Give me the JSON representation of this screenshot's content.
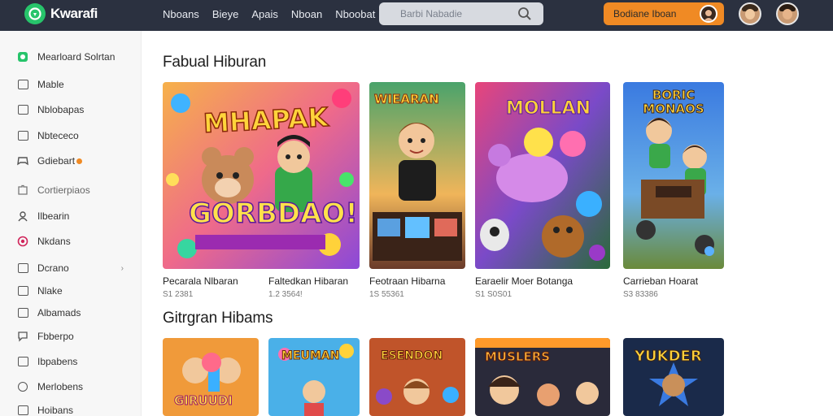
{
  "app": {
    "name": "Kwarafi"
  },
  "nav": [
    "Nboans",
    "Bieye",
    "Apais",
    "Nboan",
    "Nboobat"
  ],
  "search": {
    "placeholder": "Barbi Nabadie"
  },
  "cta": {
    "label": "Bodiane Iboan"
  },
  "sidebar": {
    "items": [
      {
        "label": "Mearloard Solrtan",
        "icon": "gamepad-icon",
        "color": "#27c46b"
      },
      {
        "label": "Mable",
        "icon": "window-icon"
      },
      {
        "label": "Nblobapas",
        "icon": "window-icon"
      },
      {
        "label": "Nbtececo",
        "icon": "window-icon"
      },
      {
        "label": "Gdiebart",
        "icon": "controller-icon"
      },
      {
        "label": "Cortierpiaos",
        "icon": "puzzle-icon"
      },
      {
        "label": "Ilbearin",
        "icon": "person-icon"
      },
      {
        "label": "Nkdans",
        "icon": "record-icon",
        "color": "#d0245a"
      },
      {
        "label": "Dcrano",
        "icon": "window-icon",
        "chevron": "›"
      },
      {
        "label": "Nlake",
        "icon": "window-icon"
      },
      {
        "label": "Albamads",
        "icon": "window-icon"
      },
      {
        "label": "Fbberpo",
        "icon": "chat-icon"
      },
      {
        "label": "Ibpabens",
        "icon": "window-icon"
      },
      {
        "label": "Merlobens",
        "icon": "globe-icon"
      },
      {
        "label": "Hoibans",
        "icon": "window-icon"
      }
    ]
  },
  "sections": [
    {
      "title": "Fabual Hiburan",
      "cards": [
        {
          "title": "Pecarala Nlbaran",
          "meta": "S1 2381",
          "art": "MHAPAK",
          "art2": "GORBDAO!"
        },
        {
          "title": "Faltedkan Hibaran",
          "meta": "1.2 3564!",
          "art": "WIEARAN"
        },
        {
          "title": "Feotraan Hibarna",
          "meta": "1S 55361",
          "art": "MOLLAN"
        },
        {
          "title": "Earaelir Moer Botanga",
          "meta": "S1 S0S01",
          "art": ""
        },
        {
          "title": "Carrieban Hoarat",
          "meta": "S3 83386",
          "art": "BORIC MONAOS"
        }
      ]
    },
    {
      "title": "Gitrgran Hibams",
      "cards": [
        {
          "art": "GIRUUDI"
        },
        {
          "art": "MEUMAN"
        },
        {
          "art": "ESENDON"
        },
        {
          "art": "MUSLERS"
        },
        {
          "art": "YUKDER"
        }
      ]
    }
  ]
}
